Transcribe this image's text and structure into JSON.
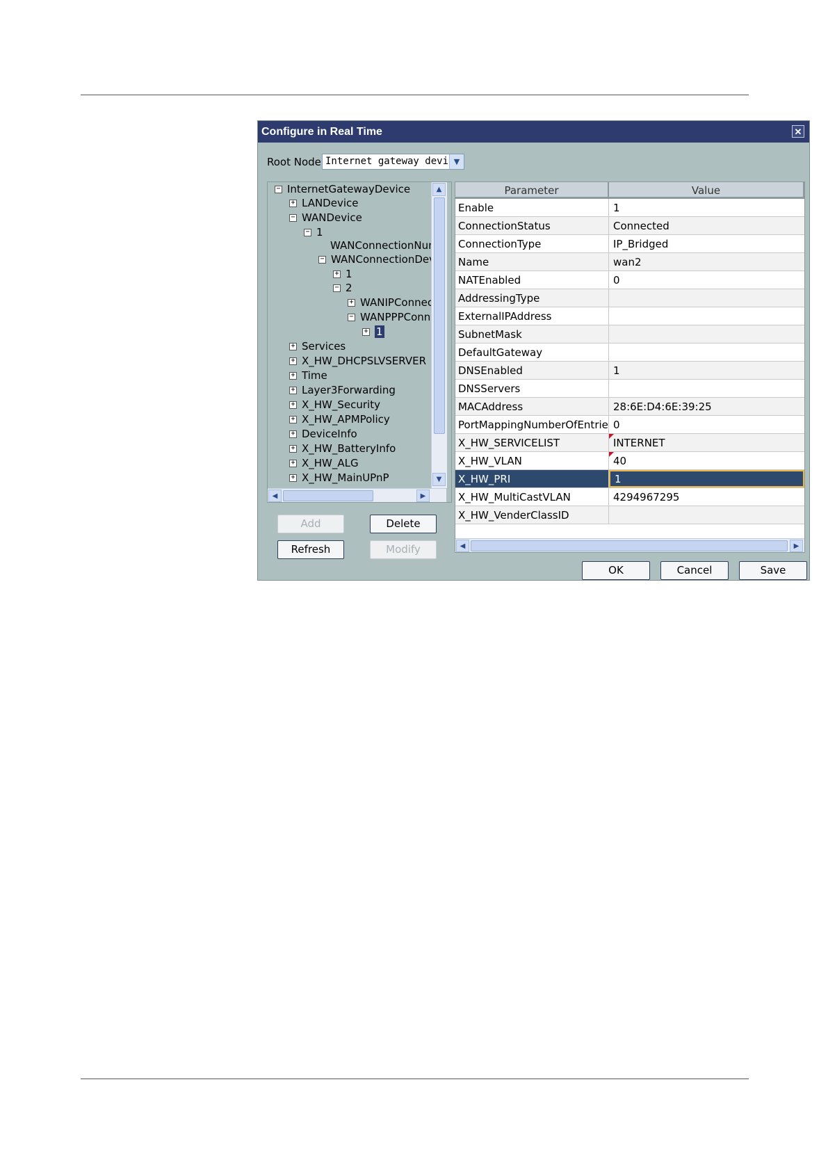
{
  "dialog": {
    "title": "Configure in Real Time",
    "close_glyph": "✕"
  },
  "root_node": {
    "label": "Root Node",
    "value": "Internet gateway device"
  },
  "tree": {
    "nodes": [
      {
        "label": "InternetGatewayDevice",
        "expander": "−"
      },
      {
        "label": "LANDevice",
        "expander": "+"
      },
      {
        "label": "WANDevice",
        "expander": "−"
      },
      {
        "label": "1",
        "expander": "−"
      },
      {
        "label": "WANConnectionNumberOfEntries",
        "expander": ""
      },
      {
        "label": "WANConnectionDevice",
        "expander": "−"
      },
      {
        "label": "1",
        "expander": "+"
      },
      {
        "label": "2",
        "expander": "−"
      },
      {
        "label": "WANIPConnection",
        "expander": "+"
      },
      {
        "label": "WANPPPConnection",
        "expander": "−"
      },
      {
        "label": "1",
        "expander": "+"
      },
      {
        "label": "Services",
        "expander": "+"
      },
      {
        "label": "X_HW_DHCPSLVSERVER",
        "expander": "+"
      },
      {
        "label": "Time",
        "expander": "+"
      },
      {
        "label": "Layer3Forwarding",
        "expander": "+"
      },
      {
        "label": "X_HW_Security",
        "expander": "+"
      },
      {
        "label": "X_HW_APMPolicy",
        "expander": "+"
      },
      {
        "label": "DeviceInfo",
        "expander": "+"
      },
      {
        "label": "X_HW_BatteryInfo",
        "expander": "+"
      },
      {
        "label": "X_HW_ALG",
        "expander": "+"
      },
      {
        "label": "X_HW_MainUPnP",
        "expander": "+"
      }
    ]
  },
  "buttons": {
    "add": "Add",
    "delete": "Delete",
    "refresh": "Refresh",
    "modify": "Modify",
    "ok": "OK",
    "cancel": "Cancel",
    "save": "Save"
  },
  "scroll": {
    "up": "▲",
    "down": "▼",
    "left": "◀",
    "right": "▶",
    "grip": "|||"
  },
  "table": {
    "headers": {
      "parameter": "Parameter",
      "value": "Value"
    },
    "rows": [
      {
        "param": "Enable",
        "value": "1"
      },
      {
        "param": "ConnectionStatus",
        "value": "Connected"
      },
      {
        "param": "ConnectionType",
        "value": "IP_Bridged"
      },
      {
        "param": "Name",
        "value": "wan2"
      },
      {
        "param": "NATEnabled",
        "value": "0"
      },
      {
        "param": "AddressingType",
        "value": ""
      },
      {
        "param": "ExternalIPAddress",
        "value": ""
      },
      {
        "param": "SubnetMask",
        "value": ""
      },
      {
        "param": "DefaultGateway",
        "value": ""
      },
      {
        "param": "DNSEnabled",
        "value": "1"
      },
      {
        "param": "DNSServers",
        "value": ""
      },
      {
        "param": "MACAddress",
        "value": "28:6E:D4:6E:39:25"
      },
      {
        "param": "PortMappingNumberOfEntries",
        "value": "0"
      },
      {
        "param": "X_HW_SERVICELIST",
        "value": "INTERNET"
      },
      {
        "param": "X_HW_VLAN",
        "value": "40"
      },
      {
        "param": "X_HW_PRI",
        "value": "1"
      },
      {
        "param": "X_HW_MultiCastVLAN",
        "value": "4294967295"
      },
      {
        "param": "X_HW_VenderClassID",
        "value": ""
      }
    ]
  }
}
